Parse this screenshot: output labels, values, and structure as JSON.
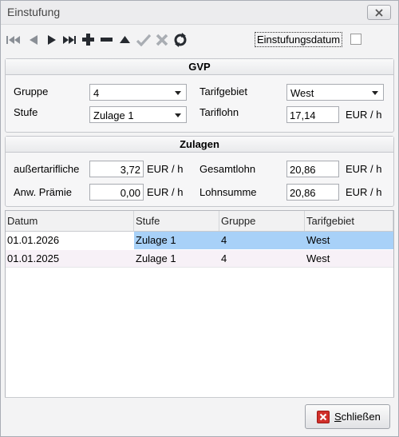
{
  "window": {
    "title": "Einstufung"
  },
  "toolbar": {
    "icons": [
      "first-icon",
      "prev-icon",
      "next-icon",
      "last-icon",
      "add-icon",
      "remove-icon",
      "up-icon",
      "confirm-icon",
      "cancel-icon",
      "refresh-icon"
    ],
    "date_label": "Einstufungsdatum",
    "date_checked": false
  },
  "gvp": {
    "header": "GVP",
    "gruppe_label": "Gruppe",
    "gruppe_value": "4",
    "stufe_label": "Stufe",
    "stufe_value": "Zulage 1",
    "tarifgebiet_label": "Tarifgebiet",
    "tarifgebiet_value": "West",
    "tariflohn_label": "Tariflohn",
    "tariflohn_value": "17,14",
    "tariflohn_unit": "EUR / h"
  },
  "zulagen": {
    "header": "Zulagen",
    "aussertarifliche_label": "außertarifliche",
    "aussertarifliche_value": "3,72",
    "aussertarifliche_unit": "EUR / h",
    "anw_praemie_label": "Anw. Prämie",
    "anw_praemie_value": "0,00",
    "anw_praemie_unit": "EUR / h",
    "gesamtlohn_label": "Gesamtlohn",
    "gesamtlohn_value": "20,86",
    "gesamtlohn_unit": "EUR / h",
    "lohnsumme_label": "Lohnsumme",
    "lohnsumme_value": "20,86",
    "lohnsumme_unit": "EUR / h"
  },
  "table": {
    "columns": [
      "Datum",
      "Stufe",
      "Gruppe",
      "Tarifgebiet"
    ],
    "rows": [
      [
        "01.01.2026",
        "Zulage 1",
        "4",
        "West"
      ],
      [
        "01.01.2025",
        "Zulage 1",
        "4",
        "West"
      ]
    ]
  },
  "footer": {
    "close_label_first": "S",
    "close_label_rest": "chließen"
  },
  "colors": {
    "selection": "#a8d1f8",
    "close_icon": "#d02f2a"
  }
}
